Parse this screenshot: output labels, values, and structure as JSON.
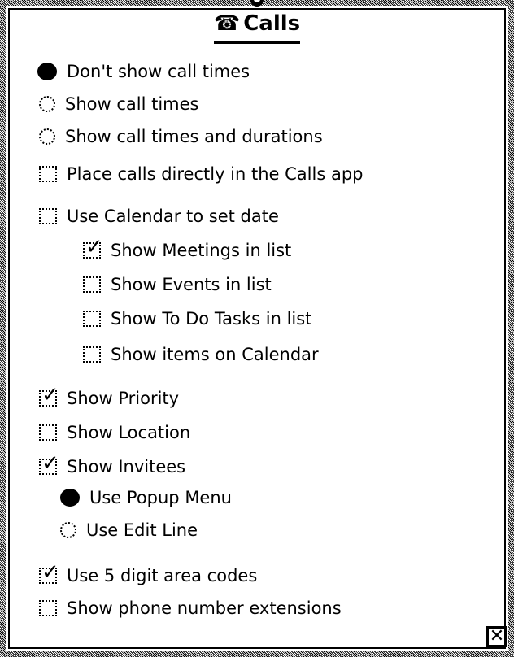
{
  "title": "Calls",
  "icons": {
    "title": "telephone-icon",
    "close": "close-box-icon"
  },
  "options": [
    {
      "id": "dont-show-call-times",
      "label": "Don't show call times",
      "kind": "radio",
      "checked": true
    },
    {
      "id": "show-call-times",
      "label": "Show call times",
      "kind": "radio",
      "checked": false
    },
    {
      "id": "show-call-times-durations",
      "label": "Show call times and durations",
      "kind": "radio",
      "checked": false
    },
    {
      "id": "place-calls-directly",
      "label": "Place calls directly in the Calls app",
      "kind": "checkbox",
      "checked": false
    },
    {
      "id": "use-calendar-date",
      "label": "Use Calendar to set date",
      "kind": "checkbox",
      "checked": false
    },
    {
      "id": "show-meetings",
      "label": "Show Meetings in list",
      "kind": "checkbox",
      "checked": true
    },
    {
      "id": "show-events",
      "label": "Show Events in list",
      "kind": "checkbox",
      "checked": false
    },
    {
      "id": "show-todo",
      "label": "Show To Do Tasks in list",
      "kind": "checkbox",
      "checked": false
    },
    {
      "id": "show-items-calendar",
      "label": "Show items on Calendar",
      "kind": "checkbox",
      "checked": false
    },
    {
      "id": "show-priority",
      "label": "Show Priority",
      "kind": "checkbox",
      "checked": true
    },
    {
      "id": "show-location",
      "label": "Show Location",
      "kind": "checkbox",
      "checked": false
    },
    {
      "id": "show-invitees",
      "label": "Show Invitees",
      "kind": "checkbox",
      "checked": true
    },
    {
      "id": "use-popup-menu",
      "label": "Use Popup Menu",
      "kind": "radio",
      "checked": true
    },
    {
      "id": "use-edit-line",
      "label": "Use Edit Line",
      "kind": "radio",
      "checked": false
    },
    {
      "id": "use-5-digit",
      "label": "Use 5 digit area codes",
      "kind": "checkbox",
      "checked": true
    },
    {
      "id": "show-extensions",
      "label": "Show phone number extensions",
      "kind": "checkbox",
      "checked": false
    }
  ],
  "check_mark": "✓",
  "close_glyph": "✕"
}
